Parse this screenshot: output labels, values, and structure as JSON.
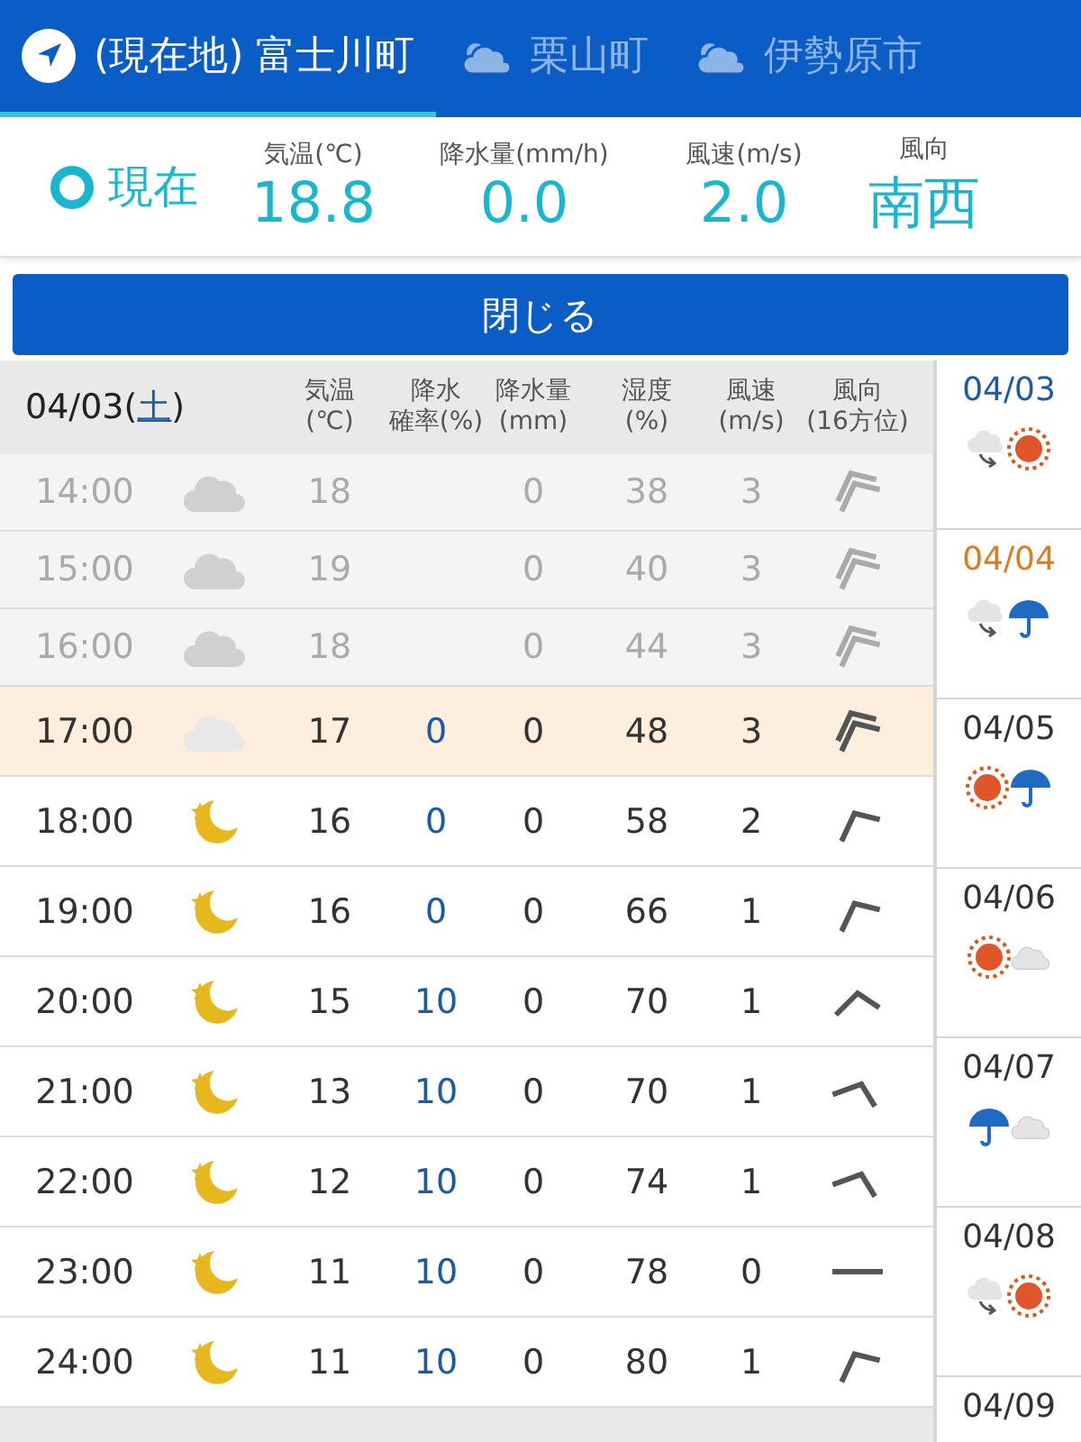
{
  "tabs": [
    {
      "label": "(現在地) 富士川町",
      "kind": "location",
      "selected": true
    },
    {
      "label": "栗山町",
      "kind": "weather",
      "selected": false
    },
    {
      "label": "伊勢原市",
      "kind": "weather",
      "selected": false
    }
  ],
  "current": {
    "label": "現在",
    "stats": [
      {
        "label": "気温(℃)",
        "value": "18.8"
      },
      {
        "label": "降水量(mm/h)",
        "value": "0.0"
      },
      {
        "label": "風速(m/s)",
        "value": "2.0"
      },
      {
        "label": "風向",
        "value": "南西"
      }
    ]
  },
  "close_button": "閉じる",
  "hourly": {
    "date": "04/03(",
    "weekday": "土",
    "date_close": ")",
    "columns": [
      {
        "top": "気温",
        "bottom": "(℃)"
      },
      {
        "top": "降水",
        "bottom": "確率(%)"
      },
      {
        "top": "降水量",
        "bottom": "(mm)"
      },
      {
        "top": "湿度",
        "bottom": "(%)"
      },
      {
        "top": "風速",
        "bottom": "(m/s)"
      },
      {
        "top": "風向",
        "bottom": "(16方位)"
      }
    ],
    "rows": [
      {
        "time": "14:00",
        "weather": {
          "kind": "cloud"
        },
        "temp": "18",
        "prob": "",
        "amount": "0",
        "humidity": "38",
        "wind": "3",
        "wind_icon": {
          "kind": "doubleleft"
        },
        "past": true,
        "now": false
      },
      {
        "time": "15:00",
        "weather": {
          "kind": "cloud"
        },
        "temp": "19",
        "prob": "",
        "amount": "0",
        "humidity": "40",
        "wind": "3",
        "wind_icon": {
          "kind": "doubleleft"
        },
        "past": true,
        "now": false
      },
      {
        "time": "16:00",
        "weather": {
          "kind": "cloud"
        },
        "temp": "18",
        "prob": "",
        "amount": "0",
        "humidity": "44",
        "wind": "3",
        "wind_icon": {
          "kind": "doubleleft"
        },
        "past": true,
        "now": false
      },
      {
        "time": "17:00",
        "weather": {
          "kind": "cloudlight"
        },
        "temp": "17",
        "prob": "0",
        "amount": "0",
        "humidity": "48",
        "wind": "3",
        "wind_icon": {
          "kind": "doubleleft"
        },
        "past": false,
        "now": true
      },
      {
        "time": "18:00",
        "weather": {
          "kind": "moon"
        },
        "temp": "16",
        "prob": "0",
        "amount": "0",
        "humidity": "58",
        "wind": "2",
        "wind_icon": {
          "kind": "left"
        },
        "past": false,
        "now": false
      },
      {
        "time": "19:00",
        "weather": {
          "kind": "moon"
        },
        "temp": "16",
        "prob": "0",
        "amount": "0",
        "humidity": "66",
        "wind": "1",
        "wind_icon": {
          "kind": "left"
        },
        "past": false,
        "now": false
      },
      {
        "time": "20:00",
        "weather": {
          "kind": "moon"
        },
        "temp": "15",
        "prob": "10",
        "amount": "0",
        "humidity": "70",
        "wind": "1",
        "wind_icon": {
          "kind": "up"
        },
        "past": false,
        "now": false
      },
      {
        "time": "21:00",
        "weather": {
          "kind": "moon"
        },
        "temp": "13",
        "prob": "10",
        "amount": "0",
        "humidity": "70",
        "wind": "1",
        "wind_icon": {
          "kind": "right"
        },
        "past": false,
        "now": false
      },
      {
        "time": "22:00",
        "weather": {
          "kind": "moon"
        },
        "temp": "12",
        "prob": "10",
        "amount": "0",
        "humidity": "74",
        "wind": "1",
        "wind_icon": {
          "kind": "right"
        },
        "past": false,
        "now": false
      },
      {
        "time": "23:00",
        "weather": {
          "kind": "moon"
        },
        "temp": "11",
        "prob": "10",
        "amount": "0",
        "humidity": "78",
        "wind": "0",
        "wind_icon": {
          "kind": "dash"
        },
        "past": false,
        "now": false
      },
      {
        "time": "24:00",
        "weather": {
          "kind": "moon"
        },
        "temp": "11",
        "prob": "10",
        "amount": "0",
        "humidity": "80",
        "wind": "1",
        "wind_icon": {
          "kind": "left"
        },
        "past": false,
        "now": false
      }
    ]
  },
  "daily": [
    {
      "date": "04/03",
      "color": "#1a5aa8",
      "icon": {
        "kind": "cloudtosun"
      }
    },
    {
      "date": "04/04",
      "color": "#e07b1a",
      "icon": {
        "kind": "cloudtorain"
      }
    },
    {
      "date": "04/05",
      "color": "#333333",
      "icon": {
        "kind": "sunrain"
      }
    },
    {
      "date": "04/06",
      "color": "#333333",
      "icon": {
        "kind": "suncloud"
      }
    },
    {
      "date": "04/07",
      "color": "#333333",
      "icon": {
        "kind": "raincloud"
      }
    },
    {
      "date": "04/08",
      "color": "#333333",
      "icon": {
        "kind": "cloudtosun"
      }
    },
    {
      "date": "04/09",
      "color": "#333333"
    }
  ]
}
